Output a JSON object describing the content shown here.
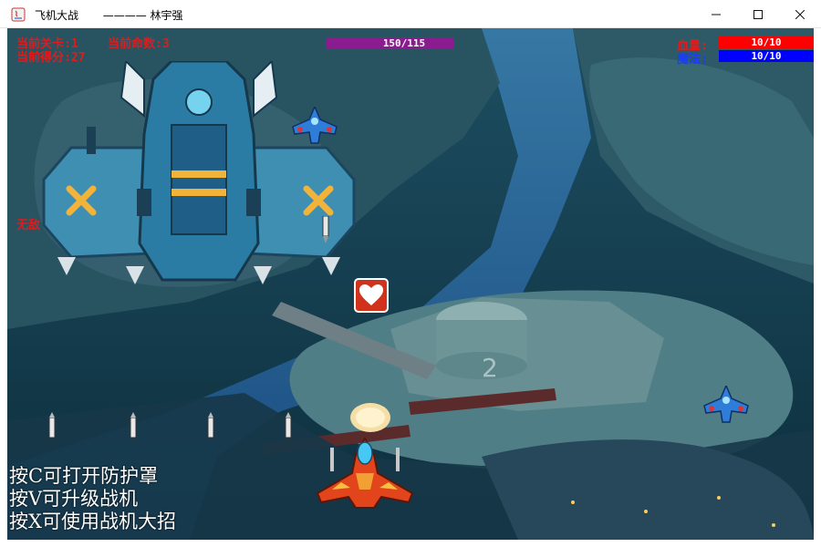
{
  "window": {
    "title": "飞机大战",
    "author": "林宇强",
    "separator": "————",
    "controls": [
      "minimize",
      "maximize",
      "close"
    ]
  },
  "hud": {
    "level_label": "当前关卡:1",
    "lives_label": "当前命数:3",
    "score_label": "当前得分:27",
    "boss_hp_text": "150/115",
    "boss_hp_fraction": 1.0,
    "invincible_label": "无敌",
    "health_label": "血量:",
    "health_text": "10/10",
    "health_fraction": 1.0,
    "mana_label": "魔法:",
    "mana_text": "10/10",
    "mana_fraction": 1.0
  },
  "hints": {
    "shield": "按C可打开防护罩",
    "upgrade": "按V可升级战机",
    "ultimate": "按X可使用战机大招"
  },
  "colors": {
    "hud_red": "#e11b1b",
    "boss_bar": "#8b1c8f",
    "health_bar": "#ff0000",
    "mana_bar": "#0000ff",
    "mana_label": "#1a3cff"
  },
  "sprites": [
    "boss-ship",
    "enemy-fighter",
    "player-fighter",
    "heart-powerup",
    "missile"
  ]
}
